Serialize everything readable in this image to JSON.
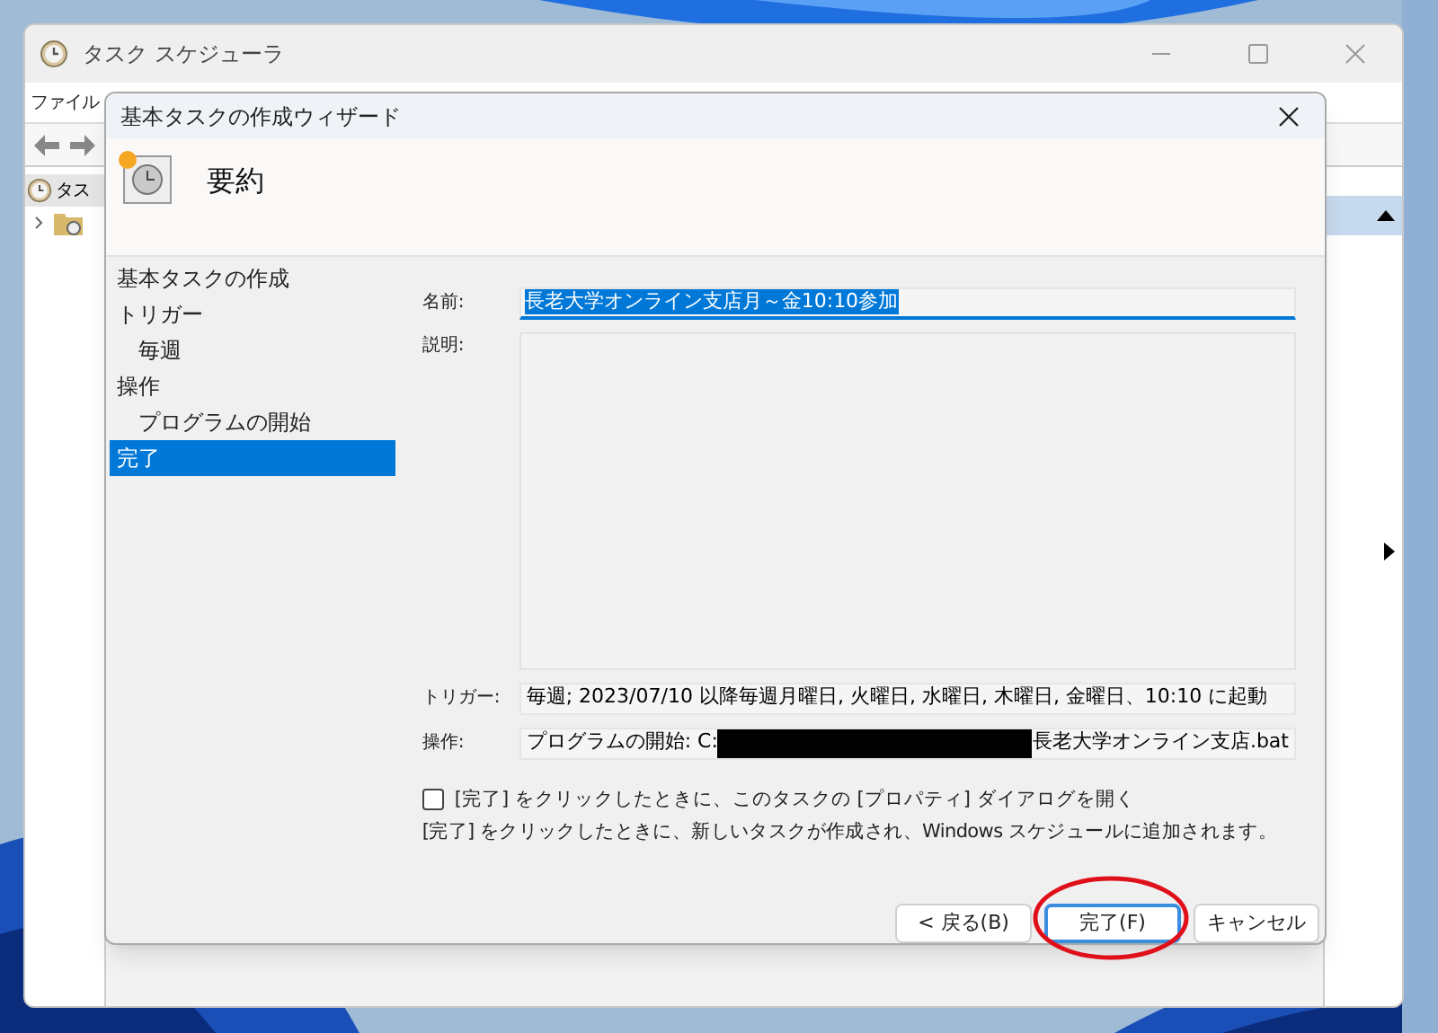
{
  "background_window": {
    "title": "タスク スケジューラ",
    "menu": [
      "ファイル"
    ],
    "tree": [
      {
        "label": "タス",
        "selected": true
      }
    ]
  },
  "dialog": {
    "title": "基本タスクの作成ウィザード",
    "page_title": "要約",
    "steps": [
      {
        "label": "基本タスクの作成",
        "selected": false
      },
      {
        "label": "トリガー",
        "selected": false,
        "children": [
          {
            "label": "毎週",
            "selected": false
          }
        ]
      },
      {
        "label": "操作",
        "selected": false,
        "children": [
          {
            "label": "プログラムの開始",
            "selected": false
          }
        ]
      },
      {
        "label": "完了",
        "selected": true
      }
    ],
    "name": {
      "label": "名前:",
      "value": "長老大学オンライン支店月～金10:10参加",
      "selected": true
    },
    "description": {
      "label": "説明:"
    },
    "trigger": {
      "label": "トリガー:",
      "value": "毎週; 2023/07/10 以降毎週月曜日, 火曜日, 水曜日, 木曜日, 金曜日、10:10 に起動"
    },
    "action": {
      "label": "操作:",
      "value_start": "プログラムの開始: C:",
      "value_end": "長老大学オンライン支店.bat",
      "redacted": true
    },
    "open_properties": {
      "label": "[完了] をクリックしたときに、このタスクの [プロパティ] ダイアログを開く",
      "checked": false
    },
    "info": "[完了] をクリックしたときに、新しいタスクが作成され、Windows スケジュールに追加されます。",
    "buttons": [
      {
        "label": "< 戻る(B)",
        "focused": false
      },
      {
        "label": "完了(F)",
        "focused": true
      },
      {
        "label": "キャンセル",
        "focused": false
      }
    ]
  },
  "annotation": {
    "kind": "ellipse"
  }
}
